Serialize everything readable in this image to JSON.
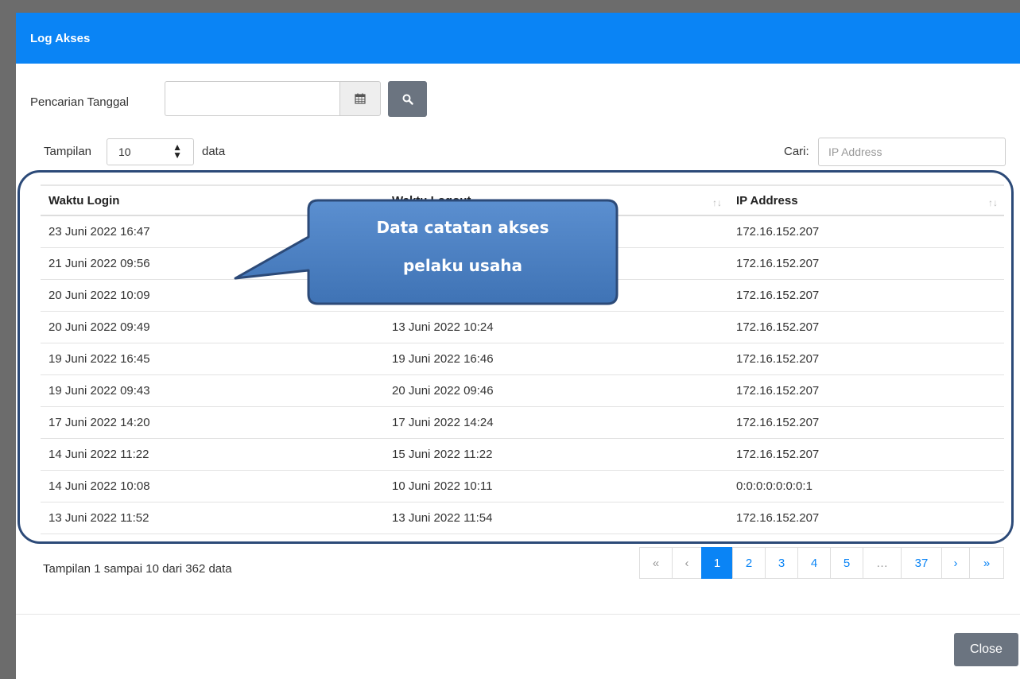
{
  "modal": {
    "title": "Log Akses"
  },
  "filter": {
    "date_label": "Pencarian Tanggal",
    "date_value": ""
  },
  "length": {
    "prefix": "Tampilan",
    "value": "10",
    "suffix": "data"
  },
  "search": {
    "label": "Cari:",
    "placeholder": "IP Address"
  },
  "table": {
    "columns": [
      "Waktu Login",
      "Waktu Logout",
      "IP Address"
    ],
    "rows": [
      [
        "23 Juni 2022 16:47",
        "",
        "172.16.152.207"
      ],
      [
        "21 Juni 2022 09:56",
        "",
        "172.16.152.207"
      ],
      [
        "20 Juni 2022 10:09",
        "",
        "172.16.152.207"
      ],
      [
        "20 Juni 2022 09:49",
        "13 Juni 2022 10:24",
        "172.16.152.207"
      ],
      [
        "19 Juni 2022 16:45",
        "19 Juni 2022 16:46",
        "172.16.152.207"
      ],
      [
        "19 Juni 2022 09:43",
        "20 Juni 2022 09:46",
        "172.16.152.207"
      ],
      [
        "17 Juni 2022 14:20",
        "17 Juni 2022 14:24",
        "172.16.152.207"
      ],
      [
        "14 Juni 2022 11:22",
        "15 Juni 2022 11:22",
        "172.16.152.207"
      ],
      [
        "14 Juni 2022 10:08",
        "10 Juni 2022 10:11",
        "0:0:0:0:0:0:0:1"
      ],
      [
        "13 Juni 2022 11:52",
        "13 Juni 2022 11:54",
        "172.16.152.207"
      ]
    ]
  },
  "info": "Tampilan 1 sampai 10 dari 362 data",
  "pagination": {
    "first": "«",
    "prev": "‹",
    "pages": [
      "1",
      "2",
      "3",
      "4",
      "5",
      "…",
      "37"
    ],
    "active": "1",
    "next": "›",
    "last": "»"
  },
  "footer": {
    "close_label": "Close"
  },
  "callout": {
    "line1": "Data catatan akses",
    "line2": "pelaku usaha"
  },
  "colors": {
    "primary": "#0a84f5",
    "button_gray": "#6b7480",
    "callout_fill": "#4f81bd",
    "callout_border": "#2c4a78"
  }
}
